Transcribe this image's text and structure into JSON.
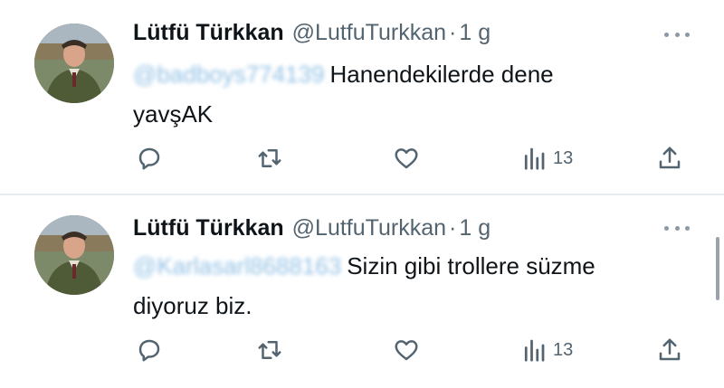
{
  "tweets": [
    {
      "author_name": "Lütfü Türkkan",
      "handle": "@LutfuTurkkan",
      "separator": "·",
      "time": "1 g",
      "mention": "@badboys774139",
      "text_line1": "Hanendekilerde dene",
      "text_line2": "yavşAK",
      "views": "13"
    },
    {
      "author_name": "Lütfü Türkkan",
      "handle": "@LutfuTurkkan",
      "separator": "·",
      "time": "1 g",
      "mention": "@Karlasarl8688163",
      "text_line1": "Sizin gibi trollere süzme",
      "text_line2": "diyoruz biz.",
      "views": "13"
    }
  ],
  "icons": {
    "reply": "reply-icon",
    "retweet": "retweet-icon",
    "like": "like-icon",
    "views": "views-icon",
    "share": "share-icon",
    "more": "more-icon"
  },
  "colors": {
    "text": "#0f1419",
    "secondary": "#536471",
    "mention_blurred": "#7fb6e0",
    "divider": "#e7ecf0"
  }
}
